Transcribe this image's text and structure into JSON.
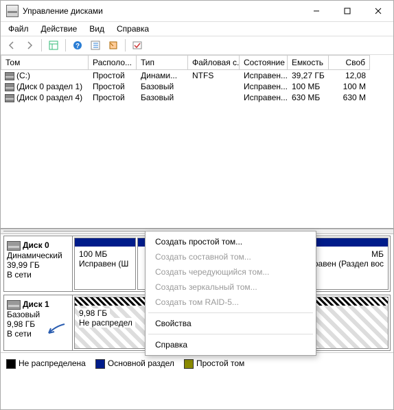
{
  "title": "Управление дисками",
  "menu": {
    "file": "Файл",
    "action": "Действие",
    "view": "Вид",
    "help": "Справка"
  },
  "columns": {
    "c0": "Том",
    "c1": "Располо...",
    "c2": "Тип",
    "c3": "Файловая с...",
    "c4": "Состояние",
    "c5": "Емкость",
    "c6": "Своб"
  },
  "volumes": [
    {
      "name": "(C:)",
      "layout": "Простой",
      "type": "Динами...",
      "fs": "NTFS",
      "status": "Исправен...",
      "cap": "39,27 ГБ",
      "free": "12,08"
    },
    {
      "name": "(Диск 0 раздел 1)",
      "layout": "Простой",
      "type": "Базовый",
      "fs": "",
      "status": "Исправен...",
      "cap": "100 МБ",
      "free": "100 М"
    },
    {
      "name": "(Диск 0 раздел 4)",
      "layout": "Простой",
      "type": "Базовый",
      "fs": "",
      "status": "Исправен...",
      "cap": "630 МБ",
      "free": "630 М"
    }
  ],
  "disks": [
    {
      "name": "Диск 0",
      "typ": "Динамический",
      "size": "39,99 ГБ",
      "net": "В сети",
      "parts": [
        {
          "band": "blue",
          "l1": "100 МБ",
          "l2": "Исправен (Ш"
        },
        {
          "band": "blue",
          "l1": "МБ",
          "l2": "равен (Раздел вос"
        }
      ]
    },
    {
      "name": "Диск 1",
      "typ": "Базовый",
      "size": "9,98 ГБ",
      "net": "В сети",
      "parts": [
        {
          "band": "hatch",
          "l1": "9,98 ГБ",
          "l2": "Не распредел",
          "unalloc": true
        }
      ]
    }
  ],
  "ctx": {
    "simple": "Создать простой том...",
    "spanned": "Создать составной том...",
    "striped": "Создать чередующийся том...",
    "mirror": "Создать зеркальный том...",
    "raid5": "Создать том RAID-5...",
    "props": "Свойства",
    "help": "Справка"
  },
  "legend": {
    "unalloc": "Не распределена",
    "primary": "Основной раздел",
    "simple": "Простой том"
  }
}
